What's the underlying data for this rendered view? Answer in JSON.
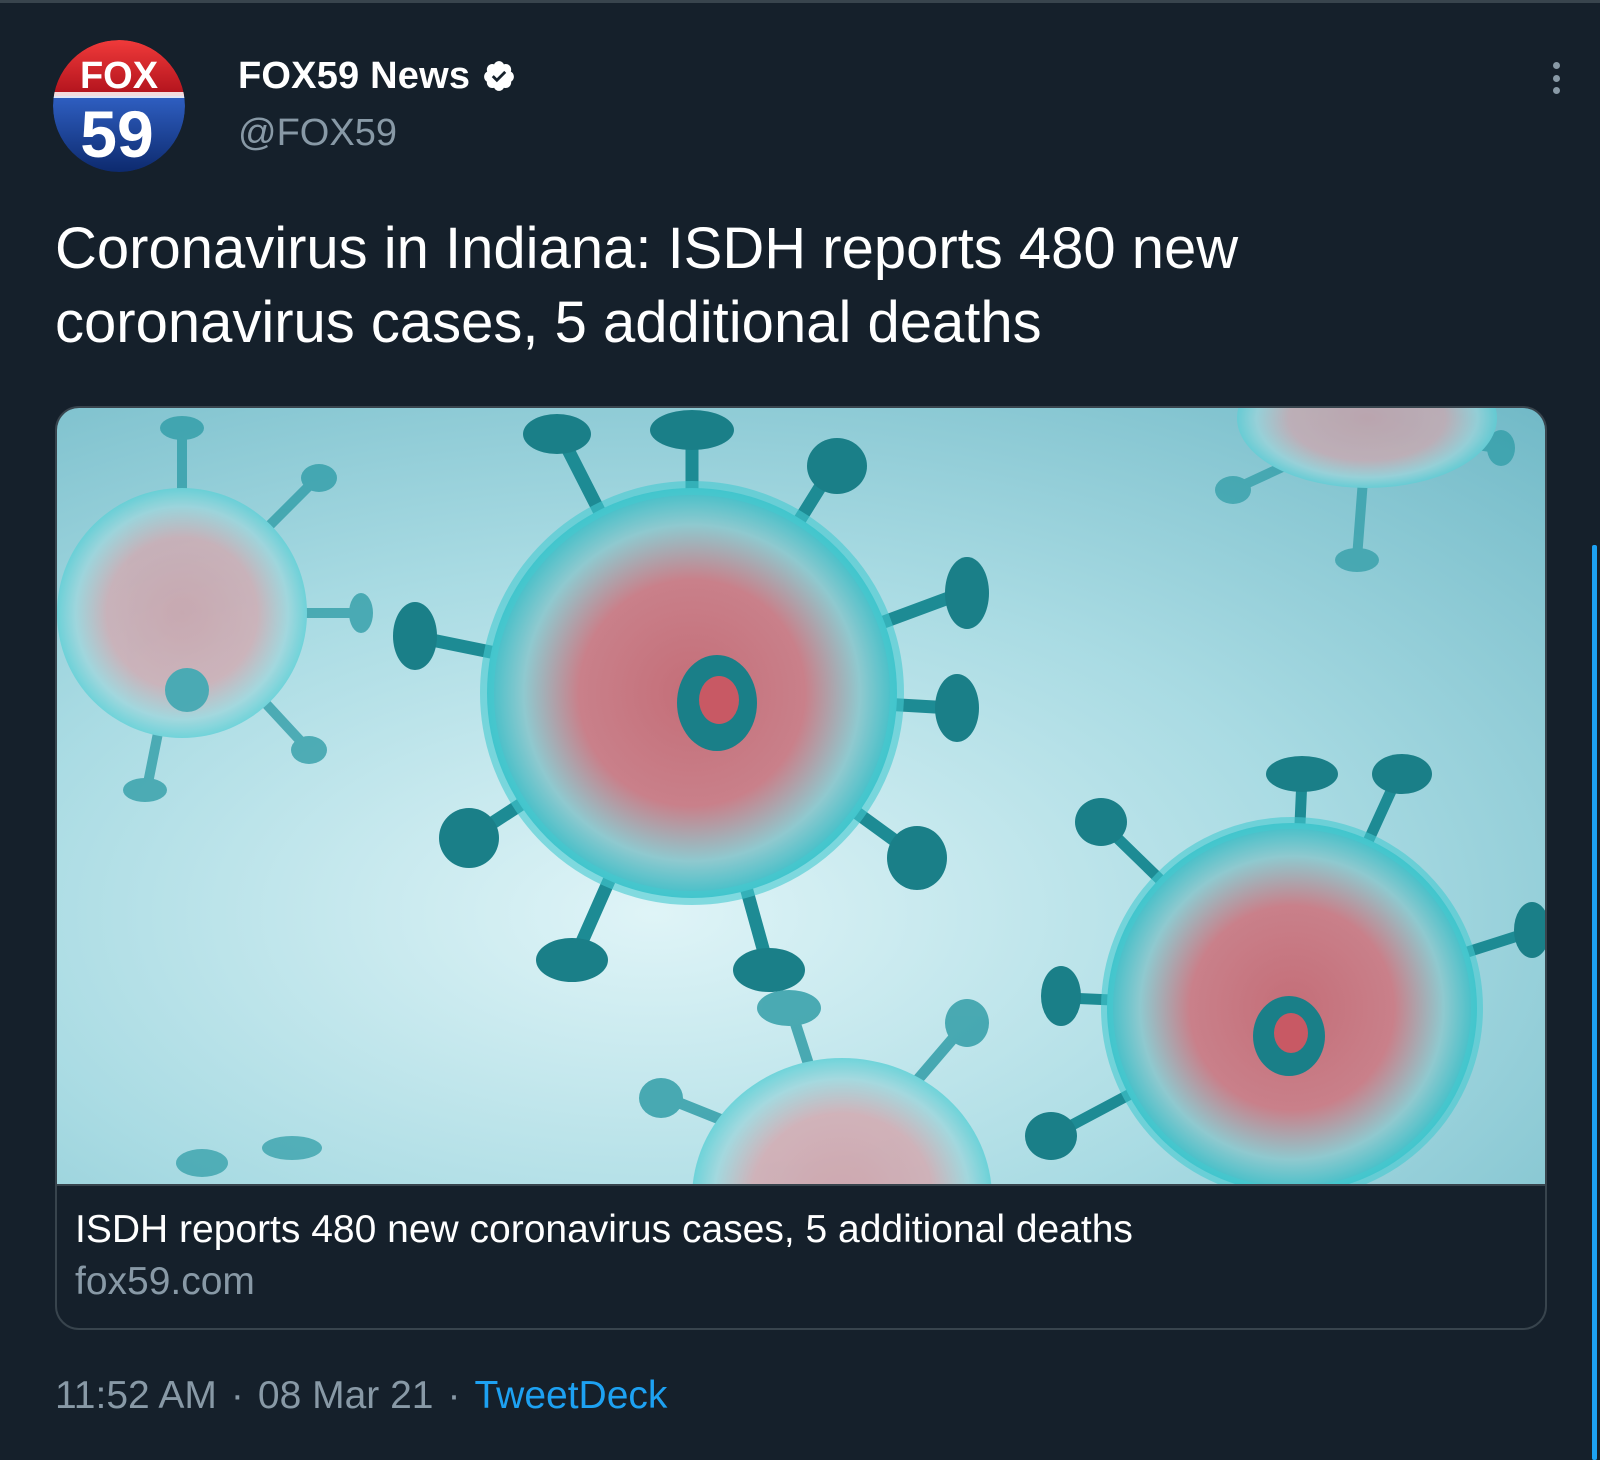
{
  "tweet": {
    "author": {
      "display_name": "FOX59 News",
      "handle": "@FOX59",
      "verified": true,
      "avatar": {
        "icon": "fox59-logo",
        "brand_top": "FOX",
        "brand_number": "59"
      }
    },
    "text": "Coronavirus in Indiana: ISDH reports 480 new coronavirus cases, 5 additional deaths",
    "card": {
      "image_subject": "coronavirus-illustration",
      "title": "ISDH reports 480 new coronavirus cases, 5 additional deaths",
      "domain": "fox59.com"
    },
    "meta": {
      "time": "11:52 AM",
      "separator": "·",
      "date": "08 Mar 21",
      "source": "TweetDeck"
    }
  },
  "colors": {
    "background": "#15202b",
    "divider": "#38444d",
    "primary_text": "#ffffff",
    "secondary_text": "#8899a6",
    "accent": "#1da1f2"
  },
  "icons": {
    "more": "more-vertical-icon",
    "verified": "verified-badge-icon"
  }
}
